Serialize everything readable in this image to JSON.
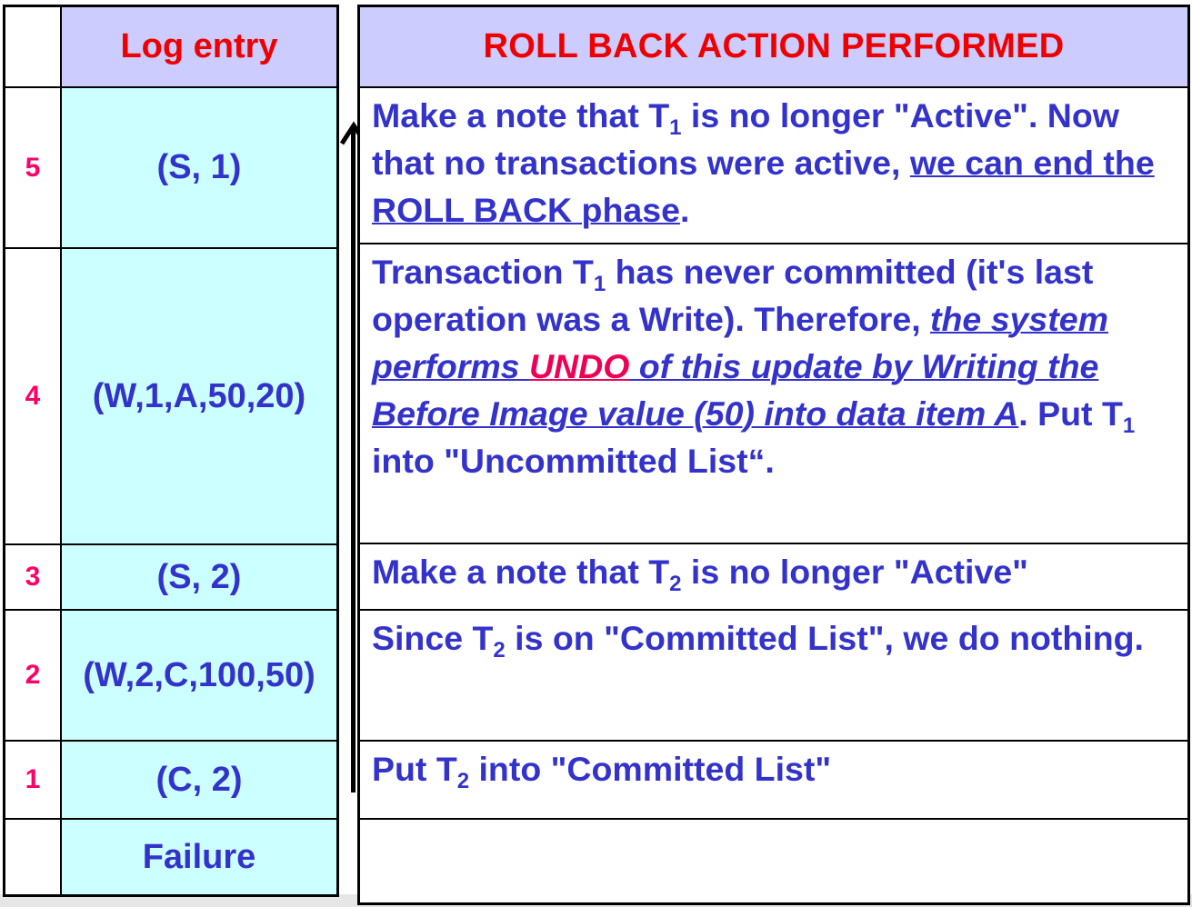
{
  "left_table": {
    "header": "Log entry",
    "rows": [
      {
        "num": "5",
        "entry": "(S, 1)"
      },
      {
        "num": "4",
        "entry": "(W,1,A,50,20)"
      },
      {
        "num": "3",
        "entry": "(S, 2)"
      },
      {
        "num": "2",
        "entry": "(W,2,C,100,50)"
      },
      {
        "num": "1",
        "entry": "(C, 2)"
      },
      {
        "num": "",
        "entry": "Failure"
      }
    ]
  },
  "right_table": {
    "header": "ROLL BACK ACTION PERFORMED",
    "row5": {
      "a": "Make a note that T",
      "sub": "1",
      "b": " is no longer \"Active\". Now that no transactions were active, ",
      "u": "we can end the ROLL BACK phase",
      "c": "."
    },
    "row4": {
      "a": "Transaction T",
      "sub1": "1",
      "b": " has never committed (it's last operation was a Write). Therefore, ",
      "i1": "the system performs ",
      "undo": "UNDO",
      "i2": " of this update by Writing the Before Image value (50) into data item A",
      "c": ". Put T",
      "sub2": "1",
      "d": " into \"Uncommitted List“."
    },
    "row3": {
      "a": "Make a note that T",
      "sub": "2",
      "b": " is no longer \"Active\""
    },
    "row2": {
      "a": "Since T",
      "sub": "2",
      "b": " is on \"Committed List\", we do nothing."
    },
    "row1": {
      "a": "Put T",
      "sub": "2",
      "b": " into \"Committed List\""
    },
    "row0": ""
  },
  "colors": {
    "header_bg": "#ccccff",
    "log_bg": "#ccffff",
    "header_text": "#ee0000",
    "body_text": "#3333cc",
    "number_text": "#ff0066"
  }
}
